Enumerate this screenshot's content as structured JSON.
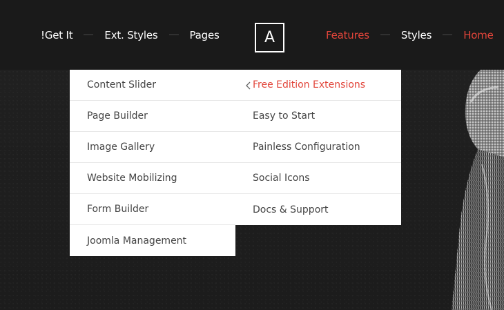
{
  "nav": {
    "left": [
      "!Get It",
      "Ext. Styles",
      "Pages"
    ],
    "right": [
      "Features",
      "Styles",
      "Home"
    ],
    "active_item": "Features",
    "logo_letter": "A"
  },
  "dropdown": {
    "left_column": [
      "Content Slider",
      "Page Builder",
      "Image Gallery",
      "Website Mobilizing",
      "Form Builder",
      "Joomla Management"
    ],
    "right_column": [
      "Free Edition Extensions",
      "Easy to Start",
      "Painless Configuration",
      "Social Icons",
      "Docs & Support"
    ],
    "active_item": "Free Edition Extensions"
  },
  "colors": {
    "accent": "#e2453a",
    "nav_bg": "#1a1a1a",
    "page_bg": "#1f1f1f",
    "menu_bg": "#ffffff",
    "menu_text": "#444444"
  }
}
